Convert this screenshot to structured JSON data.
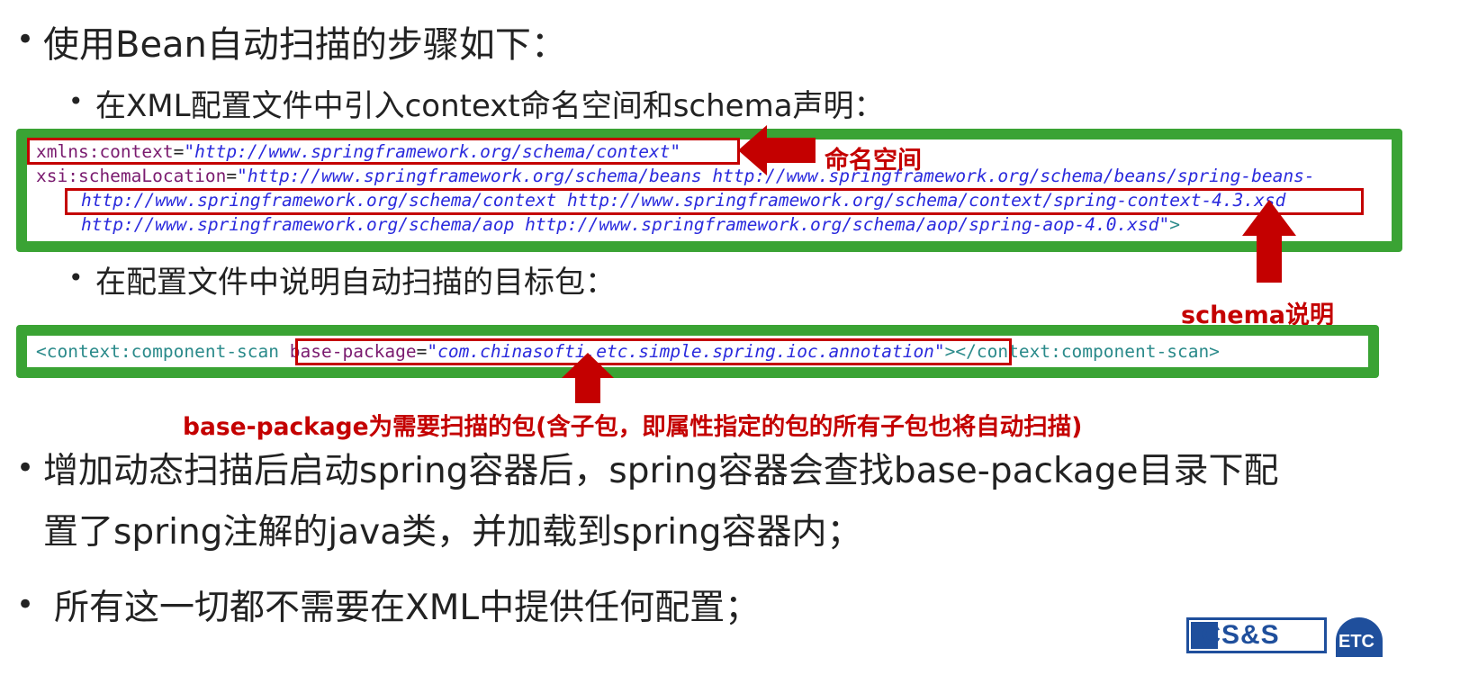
{
  "bullets": {
    "heading": "使用Bean自动扫描的步骤如下：",
    "sub1": "在XML配置文件中引入context命名空间和schema声明：",
    "sub2": "在配置文件中说明自动扫描的目标包：",
    "point3_line1": "增加动态扫描后启动spring容器后，spring容器会查找base-package目录下配",
    "point3_line2": "置了spring注解的java类，并加载到spring容器内；",
    "point4": "所有这一切都不需要在XML中提供任何配置；"
  },
  "code1": {
    "line1_attr": "xmlns:context",
    "line1_eq": "=",
    "line1_val": "\"http://www.springframework.org/schema/context\"",
    "line2_attr": "xsi:schemaLocation",
    "line2_eq": "=",
    "line2_val": "\"http://www.springframework.org/schema/beans http://www.springframework.org/schema/beans/spring-beans-",
    "line3_val": "http://www.springframework.org/schema/context http://www.springframework.org/schema/context/spring-context-4.3.xsd",
    "line4_val": "http://www.springframework.org/schema/aop http://www.springframework.org/schema/aop/spring-aop-4.0.xsd\"",
    "line4_tail": ">"
  },
  "code2": {
    "open_tag": "<context:component-scan ",
    "attr": "base-package",
    "eq": "=",
    "val": "\"com.chinasofti.etc.simple.spring.ioc.annotation\"",
    "tail": ">",
    "close_tag": "</context:component-scan>"
  },
  "annotations": {
    "namespace_label": "命名空间",
    "schema_label": "schema说明",
    "base_package_note": "base-package为需要扫描的包(含子包，即属性指定的包的所有子包也将自动扫描)"
  },
  "logo": {
    "left_text": "ICS&S",
    "right_text": "ETC"
  },
  "colors": {
    "green_border": "#3aa334",
    "red_accent": "#c40000",
    "attr": "#7a1b6f",
    "value": "#2a2add",
    "tag": "#2a8a8a",
    "logo_blue": "#1f4f9c"
  }
}
